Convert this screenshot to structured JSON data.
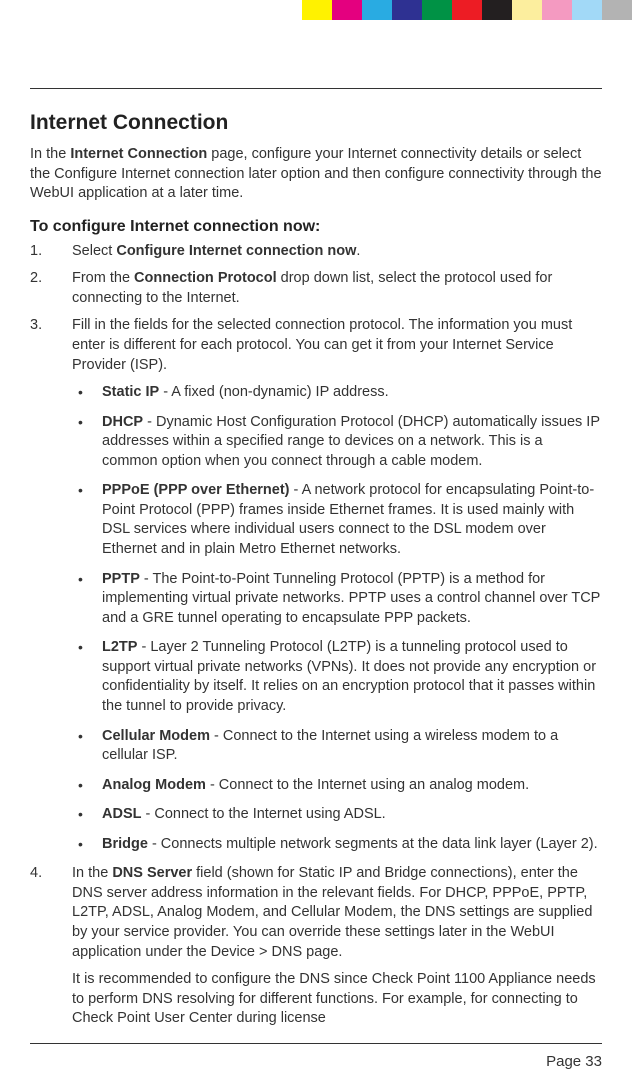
{
  "colorBars": [
    "#fff200",
    "#e4007f",
    "#29abe2",
    "#2e3192",
    "#009245",
    "#ed1c24",
    "#231f20",
    "#fcee9e",
    "#f49ac1",
    "#a2d9f7",
    "#b3b3b3"
  ],
  "heading": "Internet Connection",
  "intro_pre": "In the ",
  "intro_bold": "Internet Connection",
  "intro_post": " page, configure your Internet connectivity details or select the Configure Internet connection later option and then configure connectivity through the WebUI application at a later time.",
  "subhead": "To configure Internet connection now:",
  "step1_num": "1.",
  "step1_pre": "Select ",
  "step1_bold": "Configure Internet connection now",
  "step1_post": ".",
  "step2_num": "2.",
  "step2_pre": "From the ",
  "step2_bold": "Connection Protocol",
  "step2_post": " drop down list, select the protocol used for connecting to the Internet.",
  "step3_num": "3.",
  "step3_text": "Fill in the fields for the selected connection protocol. The information you must enter is different for each protocol. You can get it from your Internet Service Provider (ISP).",
  "b_static_t": "Static IP",
  "b_static_d": " - A fixed (non-dynamic) IP address.",
  "b_dhcp_t": "DHCP",
  "b_dhcp_d": " - Dynamic Host Configuration Protocol (DHCP) automatically issues IP addresses within a specified range to devices on a network. This is a common option when you connect through a cable modem.",
  "b_pppoe_t": "PPPoE (PPP over Ethernet)",
  "b_pppoe_d": " - A network protocol for encapsulating Point-to-Point Protocol (PPP) frames inside Ethernet frames. It is used mainly with DSL services where individual users connect to the DSL modem over Ethernet and in plain Metro Ethernet networks.",
  "b_pptp_t": "PPTP",
  "b_pptp_d": " - The Point-to-Point Tunneling Protocol (PPTP) is a method for implementing virtual private networks. PPTP uses a control channel over TCP and a GRE tunnel operating to encapsulate PPP packets.",
  "b_l2tp_t": "L2TP",
  "b_l2tp_d": " - Layer 2 Tunneling Protocol (L2TP) is a tunneling protocol used to support virtual private networks (VPNs). It does not provide any encryption or confidentiality by itself. It relies on an encryption protocol that it passes within the tunnel to provide privacy.",
  "b_cell_t": "Cellular Modem",
  "b_cell_d": " - Connect to the Internet using a wireless modem to a cellular ISP.",
  "b_analog_t": "Analog Modem",
  "b_analog_d": " - Connect to the Internet using an analog modem.",
  "b_adsl_t": "ADSL",
  "b_adsl_d": " - Connect to the Internet using ADSL.",
  "b_bridge_t": "Bridge",
  "b_bridge_d": " - Connects multiple network segments at the data link layer (Layer 2).",
  "step4_num": "4.",
  "step4_pre": "In the ",
  "step4_bold": "DNS Server",
  "step4_post": " field (shown for Static IP and Bridge connections), enter the DNS server address information in the relevant fields. For DHCP, PPPoE, PPTP, L2TP, ADSL, Analog Modem, and Cellular Modem, the DNS settings are supplied by your service provider. You can override these settings later in the WebUI application under the Device > DNS page.",
  "step4_cont": "It is recommended to configure the DNS since Check Point 1100 Appliance needs to perform DNS resolving for different functions. For example, for connecting to Check Point User Center during license",
  "page": "Page 33"
}
